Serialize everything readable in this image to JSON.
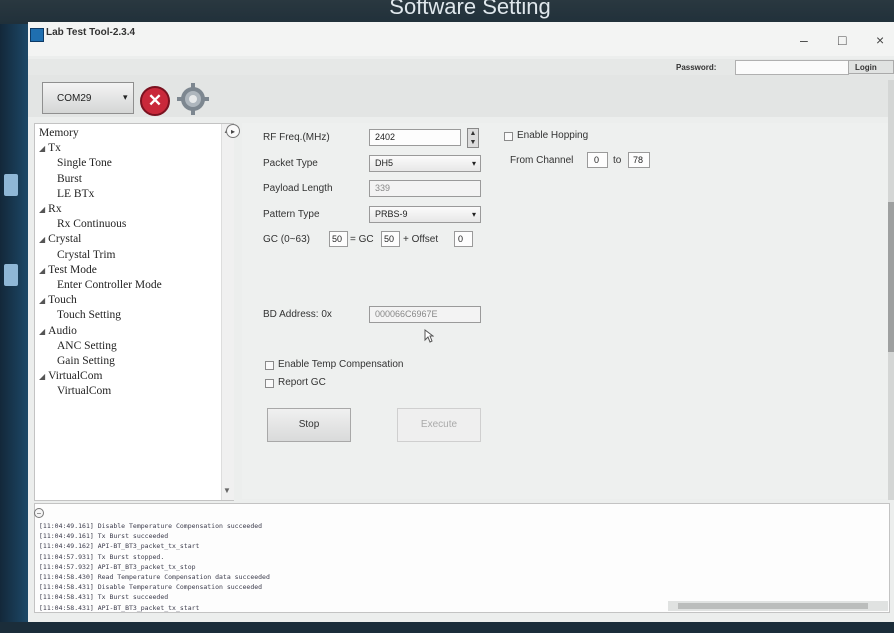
{
  "photo": {
    "caption": "Software Setting"
  },
  "window": {
    "title": "Lab Test Tool-2.3.4",
    "controls": {
      "minimize": "–",
      "maximize": "□",
      "close": "×"
    }
  },
  "login": {
    "password_label": "Password:",
    "password_value": "",
    "login_button": "Login"
  },
  "toolbar": {
    "port_value": "COM29",
    "port_arrow": "▾",
    "disconnect_glyph": "✕"
  },
  "tree": {
    "items": [
      {
        "label": "Memory",
        "level": 0,
        "expandable": false
      },
      {
        "label": "Tx",
        "level": 0,
        "expandable": true
      },
      {
        "label": "Single Tone",
        "level": 1
      },
      {
        "label": "Burst",
        "level": 1
      },
      {
        "label": "LE BTx",
        "level": 1
      },
      {
        "label": "Rx",
        "level": 0,
        "expandable": true
      },
      {
        "label": "Rx Continuous",
        "level": 1
      },
      {
        "label": "Crystal",
        "level": 0,
        "expandable": true
      },
      {
        "label": "Crystal Trim",
        "level": 1
      },
      {
        "label": "Test Mode",
        "level": 0,
        "expandable": true
      },
      {
        "label": "Enter Controller Mode",
        "level": 1
      },
      {
        "label": "Touch",
        "level": 0,
        "expandable": true
      },
      {
        "label": "Touch Setting",
        "level": 1
      },
      {
        "label": "Audio",
        "level": 0,
        "expandable": true
      },
      {
        "label": "ANC Setting",
        "level": 1
      },
      {
        "label": "Gain Setting",
        "level": 1
      },
      {
        "label": "VirtualCom",
        "level": 0,
        "expandable": true
      },
      {
        "label": "VirtualCom",
        "level": 1
      }
    ]
  },
  "form": {
    "rf_freq_label": "RF Freq.(MHz)",
    "rf_freq_value": "2402",
    "packet_type_label": "Packet Type",
    "packet_type_value": "DH5",
    "payload_length_label": "Payload Length",
    "payload_length_value": "339",
    "pattern_type_label": "Pattern Type",
    "pattern_type_value": "PRBS-9",
    "gc_label": "GC (0~63)",
    "gc_value": "50",
    "gc_equals": "= GC",
    "gc_base_value": "50",
    "offset_label": "+ Offset",
    "offset_value": "0",
    "bd_address_label": "BD Address: 0x",
    "bd_address_value": "000066C6967E",
    "enable_temp_comp_label": "Enable Temp Compensation",
    "report_gc_label": "Report GC",
    "stop_button": "Stop",
    "execute_button": "Execute",
    "enable_hopping_label": "Enable Hopping",
    "from_channel_label": "From Channel",
    "from_channel_value": "0",
    "to_label": "to",
    "to_channel_value": "78"
  },
  "log": {
    "lines": [
      "[11:04:49.161] Disable Temperature Compensation succeeded",
      "[11:04:49.161] Tx Burst succeeded",
      "[11:04:49.162] API-BT_BT3_packet_tx_start",
      "[11:04:57.931] Tx Burst stopped.",
      "[11:04:57.932] API-BT_BT3_packet_tx_stop",
      "[11:04:58.430] Read Temperature Compensation data succeeded",
      "[11:04:58.431] Disable Temperature Compensation succeeded",
      "[11:04:58.431] Tx Burst succeeded",
      "[11:04:58.431] API-BT_BT3_packet_tx_start"
    ]
  }
}
